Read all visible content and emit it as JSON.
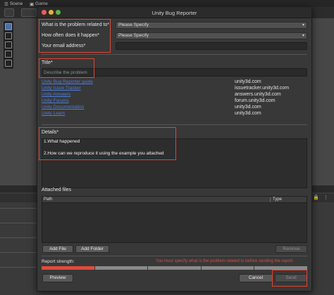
{
  "editor": {
    "tabs": [
      {
        "icon": "scene-icon",
        "label": "Scene"
      },
      {
        "icon": "game-icon",
        "label": "Game"
      }
    ]
  },
  "dialog": {
    "title": "Unity Bug Reporter",
    "problem_label": "What is the problem related to*",
    "problem_value": "Please Specify",
    "frequency_label": "How often does it happen*",
    "frequency_value": "Please Specify",
    "email_label": "Your email address*",
    "email_value": "",
    "title_label": "Title*",
    "title_placeholder": "Describe the problem",
    "resources": [
      {
        "link": "Unity Bug Reporter guide",
        "site": "unity3d.com"
      },
      {
        "link": "Unity Issue Tracker",
        "site": "issuetracker.unity3d.com"
      },
      {
        "link": "Unity Answers",
        "site": "answers.unity3d.com"
      },
      {
        "link": "Unity Forums",
        "site": "forum.unity3d.com"
      },
      {
        "link": "Unity Documentation",
        "site": "unity3d.com"
      },
      {
        "link": "Unity Learn",
        "site": "unity3d.com"
      }
    ],
    "details_label": "Details*",
    "details_lines": [
      "1.What happened",
      "2.How can we reproduce it using the example you attached"
    ],
    "attached_label": "Attached files",
    "columns": {
      "path": "Path",
      "type": "Type"
    },
    "add_file": "Add File",
    "add_folder": "Add Folder",
    "remove": "Remove",
    "strength_label": "Report strength:",
    "strength_message": "You must specify what is the problem related to before sending the report.",
    "strength_level": 0.2,
    "preview": "Preview",
    "cancel": "Cancel",
    "send": "Send"
  },
  "colors": {
    "highlight": "#e5432f",
    "link": "#4f7dd9",
    "strength_filled": "#e04b3b",
    "strength_empty": "#8a8a8a"
  }
}
